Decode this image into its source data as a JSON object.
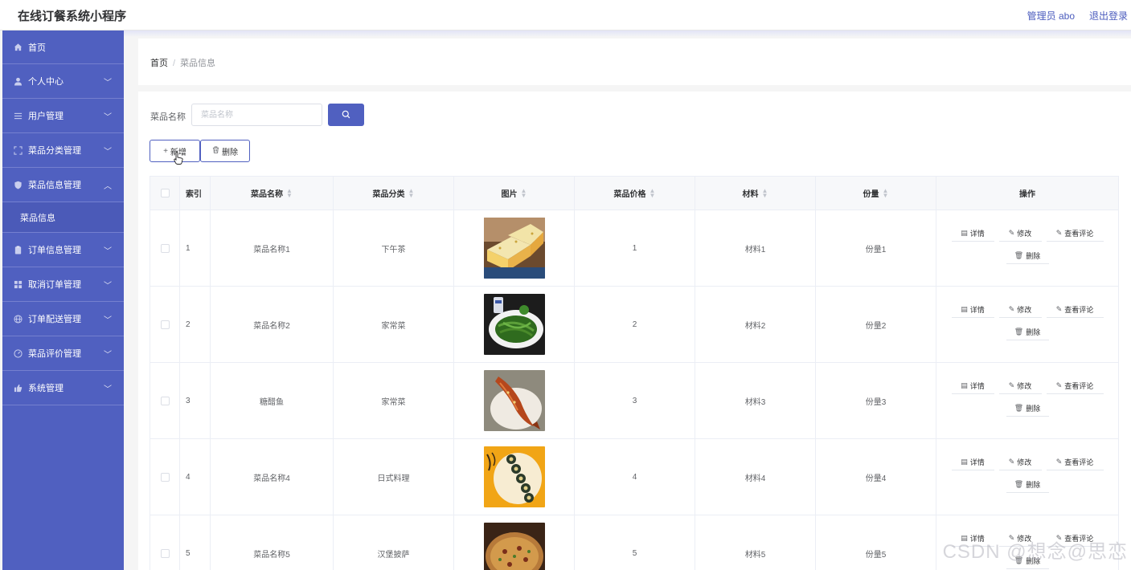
{
  "header": {
    "title": "在线订餐系统小程序",
    "admin": "管理员 abo",
    "logout": "退出登录"
  },
  "sidebar": {
    "items": [
      {
        "label": "首页",
        "icon": "home-icon",
        "expandable": false
      },
      {
        "label": "个人中心",
        "icon": "user-icon",
        "expandable": true
      },
      {
        "label": "用户管理",
        "icon": "list-icon",
        "expandable": true
      },
      {
        "label": "菜品分类管理",
        "icon": "frame-icon",
        "expandable": true
      },
      {
        "label": "菜品信息管理",
        "icon": "shield-icon",
        "expandable": true,
        "expanded": true
      },
      {
        "label": "订单信息管理",
        "icon": "clipboard-icon",
        "expandable": true
      },
      {
        "label": "取消订单管理",
        "icon": "grid-icon",
        "expandable": true
      },
      {
        "label": "订单配送管理",
        "icon": "globe-icon",
        "expandable": true
      },
      {
        "label": "菜品评价管理",
        "icon": "gauge-icon",
        "expandable": true
      },
      {
        "label": "系统管理",
        "icon": "thumb-icon",
        "expandable": true
      }
    ],
    "sub_item": "菜品信息"
  },
  "breadcrumb": {
    "home": "首页",
    "separator": "/",
    "current": "菜品信息"
  },
  "search": {
    "label": "菜品名称",
    "placeholder": "菜品名称"
  },
  "toolbar": {
    "add_label": "新增",
    "delete_label": "删除"
  },
  "table": {
    "columns": [
      "索引",
      "菜品名称",
      "菜品分类",
      "图片",
      "菜品价格",
      "材料",
      "份量",
      "操作"
    ],
    "rows": [
      {
        "index": "1",
        "name": "菜品名称1",
        "category": "下午茶",
        "image": "layer-cake",
        "price": "1",
        "material": "材料1",
        "portion": "份量1"
      },
      {
        "index": "2",
        "name": "菜品名称2",
        "category": "家常菜",
        "image": "green-beans",
        "price": "2",
        "material": "材料2",
        "portion": "份量2"
      },
      {
        "index": "3",
        "name": "糖醋鱼",
        "category": "家常菜",
        "image": "sweet-sour-fish",
        "price": "3",
        "material": "材料3",
        "portion": "份量3"
      },
      {
        "index": "4",
        "name": "菜品名称4",
        "category": "日式料理",
        "image": "sushi-rolls",
        "price": "4",
        "material": "材料4",
        "portion": "份量4"
      },
      {
        "index": "5",
        "name": "菜品名称5",
        "category": "汉堡披萨",
        "image": "pizza",
        "price": "5",
        "material": "材料5",
        "portion": "份量5"
      }
    ],
    "actions": {
      "detail": "详情",
      "edit": "修改",
      "comments": "查看评论",
      "delete": "删除"
    }
  },
  "watermark": "CSDN @想念@思恋",
  "colors": {
    "primary": "#5060c0",
    "sidebar_bg": "#5060c0"
  }
}
